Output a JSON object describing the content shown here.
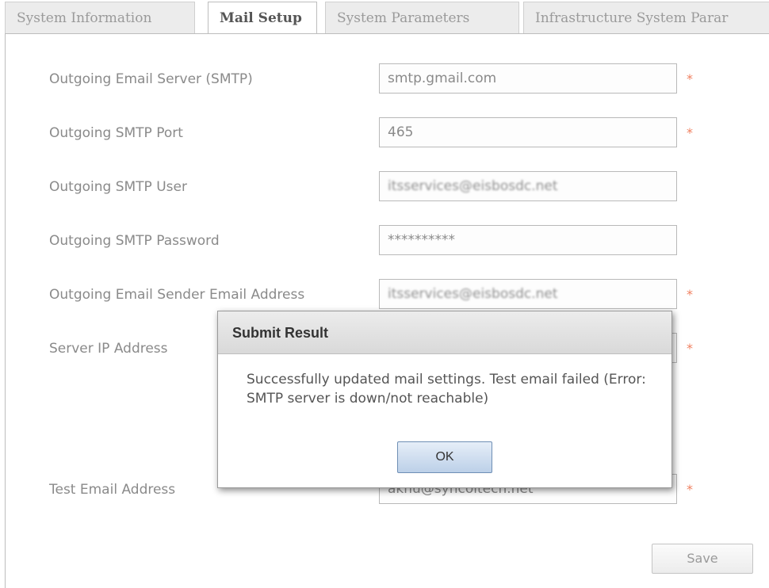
{
  "tabs": [
    {
      "label": "System Information"
    },
    {
      "label": "Mail Setup",
      "active": true
    },
    {
      "label": "System Parameters"
    },
    {
      "label": "Infrastructure System Parar"
    }
  ],
  "form": {
    "rows": [
      {
        "label": "Outgoing Email Server (SMTP)",
        "value": "smtp.gmail.com",
        "required": true
      },
      {
        "label": "Outgoing SMTP Port",
        "value": "465",
        "required": true
      },
      {
        "label": "Outgoing SMTP User",
        "value": "itsservices@eisbosdc.net",
        "required": false,
        "blurred": true
      },
      {
        "label": "Outgoing SMTP Password",
        "value": "**********",
        "required": false
      },
      {
        "label": "Outgoing Email Sender Email Address",
        "value": "itsservices@eisbosdc.net",
        "required": true,
        "blurred": true
      },
      {
        "label": "Server IP Address",
        "value": "",
        "required": true
      },
      {
        "label": "Test Email Address",
        "value": "aknu@syncoitech.net",
        "required": true
      }
    ],
    "required_mark": "*",
    "save_label": "Save"
  },
  "dialog": {
    "title": "Submit Result",
    "message": "Successfully updated mail settings. Test email failed (Error: SMTP server is down/not reachable)",
    "ok_label": "OK"
  },
  "colors": {
    "required": "#f08060",
    "ok_button": "#bcd0e8"
  }
}
